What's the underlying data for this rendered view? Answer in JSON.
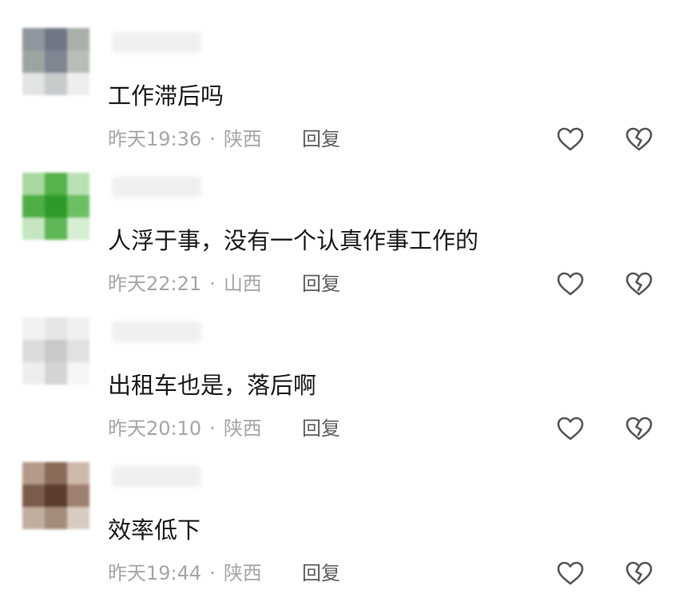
{
  "comments": [
    {
      "text": "工作滞后吗",
      "time": "昨天19:36",
      "location": "陕西",
      "reply_label": "回复",
      "avatar_colors": [
        "#8f969d",
        "#6f7784",
        "#aab0a8",
        "#9da3a0",
        "#7d8691",
        "#b8bdb7",
        "#e2e4e4",
        "#c7cbcc",
        "#eeeeee"
      ]
    },
    {
      "text": "人浮于事，没有一个认真作事工作的",
      "time": "昨天22:21",
      "location": "山西",
      "reply_label": "回复",
      "avatar_colors": [
        "#a8d8a0",
        "#55b34a",
        "#b9e0b3",
        "#4fae45",
        "#2f9a27",
        "#6cbf62",
        "#c6e6c1",
        "#5fb656",
        "#d6eed2"
      ]
    },
    {
      "text": "出租车也是，落后啊",
      "time": "昨天20:10",
      "location": "陕西",
      "reply_label": "回复",
      "avatar_colors": [
        "#f2f2f2",
        "#e6e6e6",
        "#f0f0f0",
        "#dcdcdc",
        "#c9c9c9",
        "#e1e1e1",
        "#eeeeee",
        "#d4d4d4",
        "#f5f5f5"
      ]
    },
    {
      "text": "效率低下",
      "time": "昨天19:44",
      "location": "陕西",
      "reply_label": "回复",
      "avatar_colors": [
        "#b49a8a",
        "#8a6a58",
        "#cdb9aa",
        "#7c5c4a",
        "#5a3d2e",
        "#9e8070",
        "#c2aea0",
        "#a48c7c",
        "#d8ccc2"
      ]
    }
  ],
  "separator": "·",
  "icons": {
    "like": "heart-outline-icon",
    "dislike": "broken-heart-icon"
  },
  "colors": {
    "meta_text": "#a6a6a6",
    "reply_text": "#5c5c5c",
    "icon_stroke": "#555555"
  }
}
